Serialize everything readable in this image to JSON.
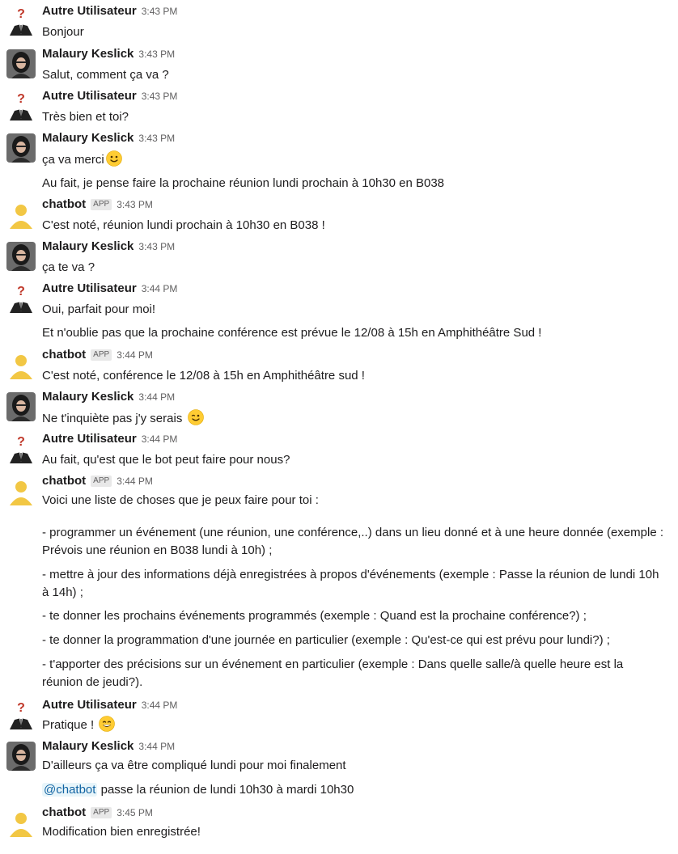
{
  "users": {
    "autre": "Autre Utilisateur",
    "malaury": "Malaury Keslick",
    "chatbot": "chatbot",
    "app_badge": "APP"
  },
  "messages": [
    {
      "author": "Autre Utilisateur",
      "time": "3:43 PM",
      "lines": [
        "Bonjour"
      ]
    },
    {
      "author": "Malaury Keslick",
      "time": "3:43 PM",
      "lines": [
        "Salut, comment ça va ?"
      ]
    },
    {
      "author": "Autre Utilisateur",
      "time": "3:43 PM",
      "lines": [
        "Très bien et toi?"
      ]
    },
    {
      "author": "Malaury Keslick",
      "time": "3:43 PM",
      "lines": [
        "ça va merci",
        "Au fait, je pense faire la prochaine réunion lundi prochain à 10h30 en B038"
      ]
    },
    {
      "author": "chatbot",
      "time": "3:43 PM",
      "lines": [
        "C'est noté, réunion lundi prochain à 10h30 en B038 !"
      ]
    },
    {
      "author": "Malaury Keslick",
      "time": "3:43 PM",
      "lines": [
        "ça te va ?"
      ]
    },
    {
      "author": "Autre Utilisateur",
      "time": "3:44 PM",
      "lines": [
        "Oui, parfait pour moi!",
        "Et n'oublie pas que la prochaine conférence est prévue le 12/08 à 15h en Amphithéâtre Sud !"
      ]
    },
    {
      "author": "chatbot",
      "time": "3:44 PM",
      "lines": [
        "C'est noté, conférence le 12/08 à 15h en Amphithéâtre sud !"
      ]
    },
    {
      "author": "Malaury Keslick",
      "time": "3:44 PM",
      "lines": [
        "Ne t'inquiète pas j'y serais"
      ]
    },
    {
      "author": "Autre Utilisateur",
      "time": "3:44 PM",
      "lines": [
        "Au fait, qu'est que le bot peut faire pour nous?"
      ]
    },
    {
      "author": "chatbot",
      "time": "3:44 PM",
      "lines": [
        "Voici une liste de choses que je peux faire pour toi :",
        "- programmer un événement (une réunion, une conférence,..) dans un lieu donné et à une heure donnée (exemple : Prévois une réunion en B038 lundi à 10h) ;",
        "- mettre à jour des informations déjà enregistrées à propos d'événements (exemple : Passe la réunion de lundi 10h à 14h) ;",
        "- te donner les prochains événements programmés (exemple : Quand est la prochaine conférence?) ;",
        "- te donner la programmation d'une journée en particulier (exemple : Qu'est-ce qui est prévu pour lundi?) ;",
        "- t'apporter des précisions sur un événement en particulier (exemple : Dans quelle salle/à quelle heure est la réunion de jeudi?)."
      ]
    },
    {
      "author": "Autre Utilisateur",
      "time": "3:44 PM",
      "lines": [
        "Pratique !"
      ]
    },
    {
      "author": "Malaury Keslick",
      "time": "3:44 PM",
      "lines": [
        "D'ailleurs ça va être compliqué lundi pour moi finalement",
        "passe la réunion de lundi 10h30 à mardi 10h30"
      ],
      "mention": "@chatbot"
    },
    {
      "author": "chatbot",
      "time": "3:45 PM",
      "lines": [
        "Modification bien enregistrée!"
      ]
    }
  ],
  "icons": {
    "smile_emoji": "slightly-smiling-face-icon",
    "wink_emoji": "winking-face-icon",
    "grin_emoji": "grinning-face-icon"
  },
  "colors": {
    "bot_avatar": "#f2c744",
    "mention_text": "#1264a3",
    "mention_bg": "#e8f5fa"
  }
}
